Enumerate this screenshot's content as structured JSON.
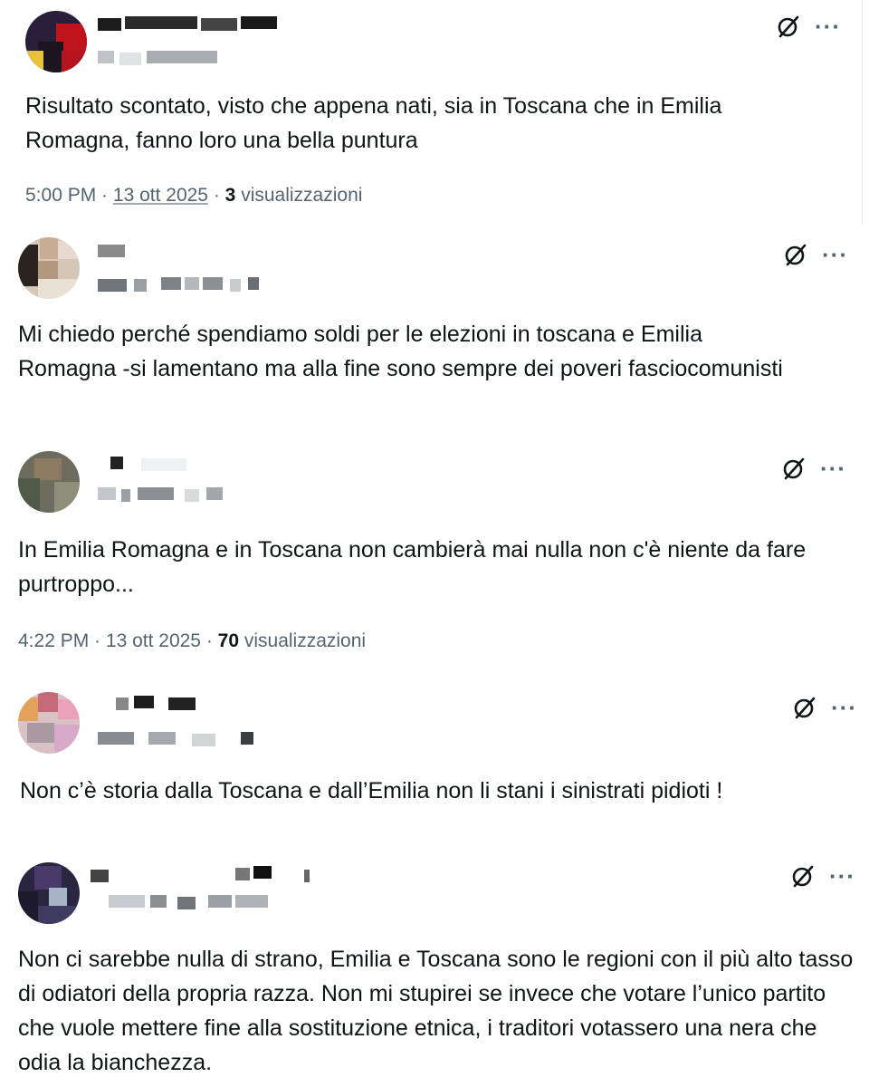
{
  "posts": [
    {
      "text": "Risultato scontato, visto che appena nati, sia in Toscana che in Emilia Romagna, fanno loro una bella puntura",
      "time": "5:00 PM",
      "date": "13 ott 2025",
      "views_count": "3",
      "views_label": "visualizzazioni"
    },
    {
      "text": "Mi chiedo perché spendiamo soldi per le elezioni in toscana e Emilia Romagna -si lamentano ma alla fine sono sempre dei poveri fasciocomunisti"
    },
    {
      "text": "In Emilia Romagna e in Toscana non cambierà mai nulla non c'è niente da fare purtroppo...",
      "time": "4:22 PM",
      "date": "13 ott 2025",
      "views_count": "70",
      "views_label": "visualizzazioni"
    },
    {
      "text": "Non c’è storia dalla Toscana e dall’Emilia non li stani i sinistrati pidioti !"
    },
    {
      "text": "Non ci sarebbe nulla di strano, Emilia e Toscana sono le regioni con il più alto tasso di odiatori della propria razza. Non mi stupirei se invece che votare l’unico partito che vuole mettere fine alla sostituzione etnica, i traditori votassero una nera che odia la bianchezza."
    }
  ],
  "separator": " · ",
  "icons": {
    "grok": "grok-icon",
    "more": "more-icon"
  },
  "more_glyph": "···"
}
